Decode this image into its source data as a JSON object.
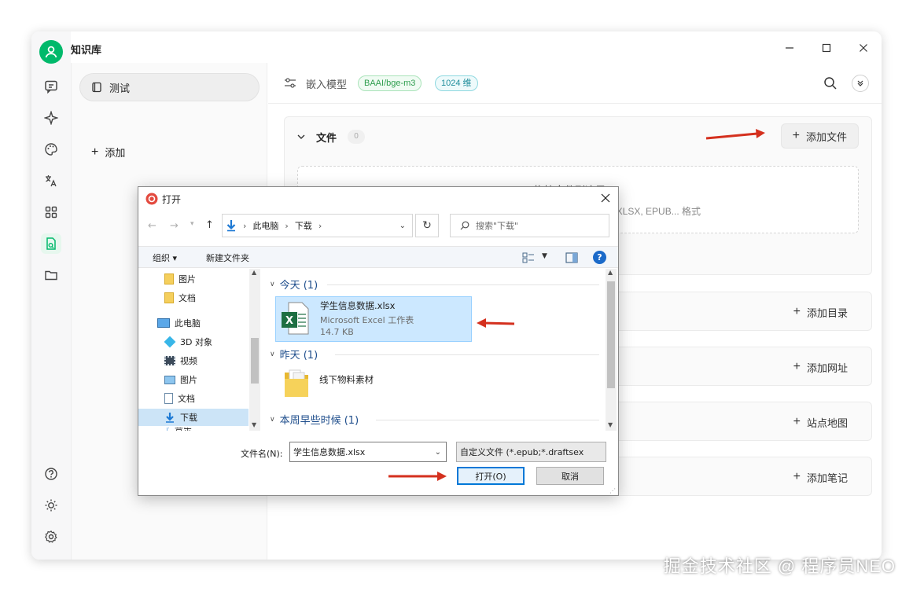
{
  "app": {
    "title": "知识库",
    "window_controls": [
      "minimize",
      "maximize",
      "close"
    ]
  },
  "rail": {
    "icons": [
      "chat-icon",
      "sparkle-icon",
      "palette-icon",
      "translate-icon",
      "apps-grid-icon",
      "knowledge-base-icon",
      "folder-icon"
    ],
    "bottom_icons": [
      "help-icon",
      "brightness-icon",
      "settings-icon"
    ],
    "active": "knowledge-base-icon"
  },
  "sidebar": {
    "items": [
      {
        "label": "测试",
        "icon": "book-icon"
      }
    ],
    "add_label": "添加"
  },
  "topbar": {
    "embed_label": "嵌入模型",
    "model_tag": "BAAI/bge-m3",
    "dims_tag": "1024 维"
  },
  "sections": {
    "files": {
      "title": "文件",
      "count": "0",
      "add_button": "添加文件",
      "drop_hint_partial": "拖拽文件到这里",
      "formats_partial": "X, XLSX, EPUB... 格式"
    },
    "directory": {
      "add_button": "添加目录"
    },
    "url": {
      "add_button": "添加网址"
    },
    "sitemap": {
      "add_button": "站点地图"
    },
    "notes": {
      "add_button": "添加笔记"
    }
  },
  "dialog": {
    "title": "打开",
    "path": [
      "此电脑",
      "下载"
    ],
    "search_placeholder": "搜索\"下载\"",
    "toolbar": {
      "organize": "组织 ▾",
      "new_folder": "新建文件夹"
    },
    "nav_items": [
      {
        "label": "图片",
        "icon": "folder-yellow-icon"
      },
      {
        "label": "文档",
        "icon": "folder-yellow-icon"
      },
      {
        "label": "此电脑",
        "icon": "computer-icon"
      },
      {
        "label": "3D 对象",
        "icon": "cube-3d-icon"
      },
      {
        "label": "视频",
        "icon": "video-icon"
      },
      {
        "label": "图片",
        "icon": "pictures-icon"
      },
      {
        "label": "文档",
        "icon": "documents-icon"
      },
      {
        "label": "下载",
        "icon": "download-arrow-icon",
        "selected": true
      },
      {
        "label": "音乐",
        "icon": "music-icon"
      }
    ],
    "groups": [
      {
        "title": "今天 (1)"
      },
      {
        "title": "昨天 (1)"
      },
      {
        "title": "本周早些时候 (1)"
      }
    ],
    "selected_file": {
      "name": "学生信息数据.xlsx",
      "type": "Microsoft Excel 工作表",
      "size": "14.7 KB"
    },
    "folder": {
      "name": "线下物料素材"
    },
    "filename_label": "文件名(N):",
    "filename_value": "学生信息数据.xlsx",
    "filetype": "自定义文件 (*.epub;*.draftsex",
    "open_button": "打开(O)",
    "cancel_button": "取消"
  },
  "watermark": "掘金技术社区 @ 程序员NEO",
  "colors": {
    "accent": "#00b96b",
    "arrow": "#d4301e",
    "selection": "#cce8ff",
    "excel": "#1d6f42"
  }
}
